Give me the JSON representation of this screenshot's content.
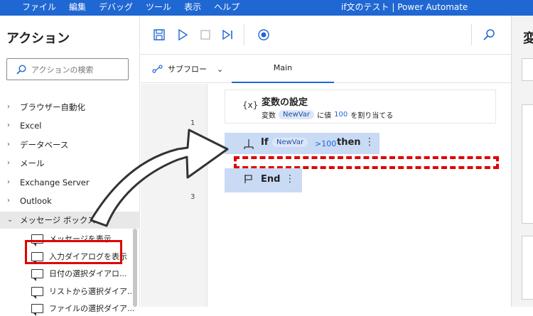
{
  "menu": [
    "ファイル",
    "編集",
    "デバッグ",
    "ツール",
    "表示",
    "ヘルプ"
  ],
  "window_title": "if文のテスト | Power Automate",
  "actions_panel": {
    "title": "アクション",
    "search_placeholder": "アクションの検索",
    "categories": [
      "ブラウザー自動化",
      "Excel",
      "データベース",
      "メール",
      "Exchange Server",
      "Outlook",
      "メッセージ ボックス"
    ],
    "sub_items": [
      "メッセージを表示",
      "入力ダイアログを表示",
      "日付の選択ダイアロ...",
      "リストから選択ダイア...",
      "ファイルの選択ダイア..."
    ]
  },
  "designer": {
    "subflow_label": "サブフロー",
    "main_tab": "Main",
    "line_numbers": [
      "1",
      "2",
      "3"
    ],
    "step1": {
      "icon": "{x}",
      "title": "変数の設定",
      "desc_prefix": "変数",
      "var": "NewVar",
      "desc_mid": "に値",
      "value": "100",
      "desc_suffix": "を割り当てる"
    },
    "step2": {
      "keyword": "If",
      "var": "NewVar",
      "cond": ">100",
      "then": "then"
    },
    "step3": {
      "keyword": "End"
    }
  },
  "properties_panel": {
    "title": "変"
  },
  "colors": {
    "titlebar": "#1f67d2",
    "highlight_red": "#e00000",
    "step_selected": "#c9daf5"
  }
}
